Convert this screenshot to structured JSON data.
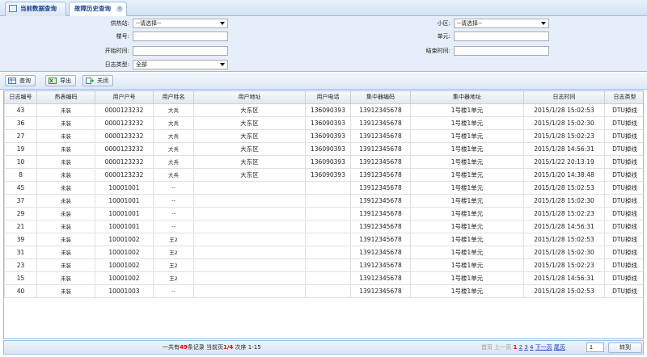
{
  "tabs": [
    {
      "label": "当前数据查询"
    },
    {
      "label": "故障历史查询"
    }
  ],
  "filters": {
    "heat_station": {
      "label": "供热站:",
      "value": "--请选择--"
    },
    "meter_no": {
      "label": "楼号:",
      "value": ""
    },
    "start_time": {
      "label": "开始时间:",
      "value": ""
    },
    "meter_type": {
      "label": "日志类型:",
      "value": "全部"
    },
    "district": {
      "label": "小区:",
      "value": "--请选择--"
    },
    "unit": {
      "label": "单元:",
      "value": ""
    },
    "end_time": {
      "label": "结束时间:",
      "value": ""
    }
  },
  "toolbar": {
    "query_label": "查询",
    "export_label": "导出",
    "close_label": "关闭"
  },
  "table": {
    "columns": [
      "日志编号",
      "热表编码",
      "用户户号",
      "用户姓名",
      "用户地址",
      "用户电话",
      "集中器编码",
      "集中器地址",
      "日志时间",
      "日志类型"
    ],
    "rows": [
      [
        "43",
        "未装",
        "0000123232",
        "大兵",
        "大东区",
        "136090393",
        "13912345678",
        "1号楼1单元",
        "2015/1/28 15:02:53",
        "DTU掉线"
      ],
      [
        "36",
        "未装",
        "0000123232",
        "大兵",
        "大东区",
        "136090393",
        "13912345678",
        "1号楼1单元",
        "2015/1/28 15:02:30",
        "DTU掉线"
      ],
      [
        "27",
        "未装",
        "0000123232",
        "大兵",
        "大东区",
        "136090393",
        "13912345678",
        "1号楼1单元",
        "2015/1/28 15:02:23",
        "DTU掉线"
      ],
      [
        "19",
        "未装",
        "0000123232",
        "大兵",
        "大东区",
        "136090393",
        "13912345678",
        "1号楼1单元",
        "2015/1/28 14:56:31",
        "DTU掉线"
      ],
      [
        "10",
        "未装",
        "0000123232",
        "大兵",
        "大东区",
        "136090393",
        "13912345678",
        "1号楼1单元",
        "2015/1/22 20:13:19",
        "DTU掉线"
      ],
      [
        "8",
        "未装",
        "0000123232",
        "大兵",
        "大东区",
        "136090393",
        "13912345678",
        "1号楼1单元",
        "2015/1/20 14:38:48",
        "DTU掉线"
      ],
      [
        "45",
        "未装",
        "10001001",
        "--",
        "",
        "",
        "13912345678",
        "1号楼1单元",
        "2015/1/28 15:02:53",
        "DTU掉线"
      ],
      [
        "37",
        "未装",
        "10001001",
        "--",
        "",
        "",
        "13912345678",
        "1号楼1单元",
        "2015/1/28 15:02:30",
        "DTU掉线"
      ],
      [
        "29",
        "未装",
        "10001001",
        "--",
        "",
        "",
        "13912345678",
        "1号楼1单元",
        "2015/1/28 15:02:23",
        "DTU掉线"
      ],
      [
        "21",
        "未装",
        "10001001",
        "--",
        "",
        "",
        "13912345678",
        "1号楼1单元",
        "2015/1/28 14:56:31",
        "DTU掉线"
      ],
      [
        "39",
        "未装",
        "10001002",
        "王2",
        "",
        "",
        "13912345678",
        "1号楼1单元",
        "2015/1/28 15:02:53",
        "DTU掉线"
      ],
      [
        "31",
        "未装",
        "10001002",
        "王2",
        "",
        "",
        "13912345678",
        "1号楼1单元",
        "2015/1/28 15:02:30",
        "DTU掉线"
      ],
      [
        "23",
        "未装",
        "10001002",
        "王2",
        "",
        "",
        "13912345678",
        "1号楼1单元",
        "2015/1/28 15:02:23",
        "DTU掉线"
      ],
      [
        "15",
        "未装",
        "10001002",
        "王2",
        "",
        "",
        "13912345678",
        "1号楼1单元",
        "2015/1/28 14:56:31",
        "DTU掉线"
      ],
      [
        "40",
        "未装",
        "10001003",
        "--",
        "",
        "",
        "13912345678",
        "1号楼1单元",
        "2015/1/28 15:02:53",
        "DTU掉线"
      ]
    ]
  },
  "pager": {
    "total_prefix": "一共有",
    "total_count": "49",
    "total_suffix": "条记录",
    "current_prefix": "当前页",
    "current_page": "1/4",
    "range_text": "次序 1-15",
    "first_label": "首页",
    "prev_label": "上一页",
    "pages": [
      "1",
      "2",
      "3",
      "4"
    ],
    "next_label": "下一页",
    "last_label": "尾页",
    "jump_value": "1",
    "jump_label": "转到"
  }
}
